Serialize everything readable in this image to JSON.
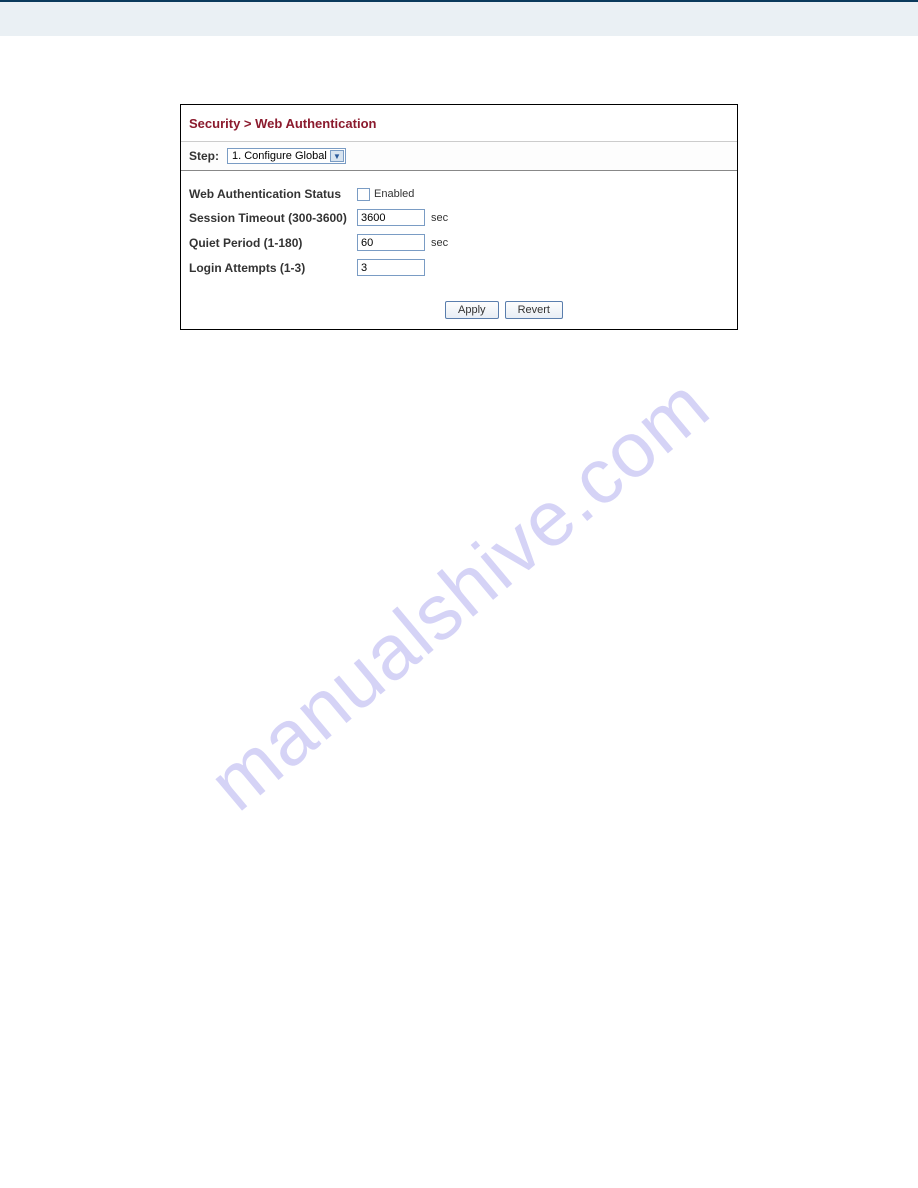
{
  "breadcrumb": "Security > Web Authentication",
  "step": {
    "label": "Step:",
    "selected": "1. Configure Global"
  },
  "fields": {
    "auth_status": {
      "label": "Web Authentication Status",
      "checkbox_label": "Enabled",
      "checked": false
    },
    "session_timeout": {
      "label": "Session Timeout (300-3600)",
      "value": "3600",
      "unit": "sec"
    },
    "quiet_period": {
      "label": "Quiet Period (1-180)",
      "value": "60",
      "unit": "sec"
    },
    "login_attempts": {
      "label": "Login Attempts (1-3)",
      "value": "3"
    }
  },
  "buttons": {
    "apply": "Apply",
    "revert": "Revert"
  },
  "watermark": "manualshive.com"
}
